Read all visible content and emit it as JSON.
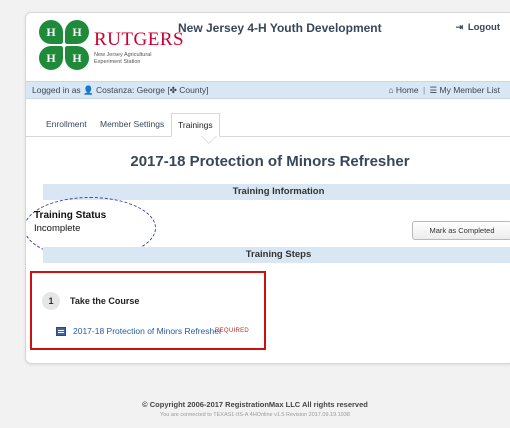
{
  "header": {
    "logo_name": "RUTGERS",
    "logo_subtitle": "New Jersey Agricultural Experiment Station",
    "site_title": "New Jersey 4-H Youth Development",
    "logout_label": "Logout",
    "clover_letter": "H"
  },
  "status_bar": {
    "logged_in_prefix": "Logged in as",
    "user_name": "Costanza: George [",
    "county": "County]",
    "home_label": "Home",
    "member_list_label": "My Member List"
  },
  "tabs": [
    {
      "label": "Enrollment"
    },
    {
      "label": "Member Settings"
    },
    {
      "label": "Trainings"
    }
  ],
  "page": {
    "title": "2017-18 Protection of Minors Refresher"
  },
  "training_info": {
    "header": "Training Information",
    "status_label": "Training Status",
    "status_value": "Incomplete",
    "complete_button": "Mark as Completed"
  },
  "training_steps": {
    "header": "Training Steps",
    "steps": [
      {
        "number": "1",
        "title": "Take the Course",
        "course_link": "2017-18 Protection of Minors Refresher",
        "tag": "REQUIRED"
      }
    ]
  },
  "footer": {
    "copyright": "© Copyright 2006-2017 RegistrationMax LLC All rights reserved",
    "connection": "You are connected to TEXAS1-IIS-A  4HOnline v1.5 Revision 2017.09.19.1938"
  },
  "colors": {
    "accent_blue": "#d9e7f4",
    "title_navy": "#37475a",
    "rutgers_red": "#cc0033",
    "clover_green": "#1f8a3a",
    "highlight_red": "#cc1111",
    "annotation_blue": "#3344aa"
  },
  "icons": {
    "logout": "sign-out-icon",
    "user": "user-icon",
    "county": "clover-icon",
    "home": "home-icon",
    "member_list": "list-icon",
    "course": "course-icon"
  }
}
